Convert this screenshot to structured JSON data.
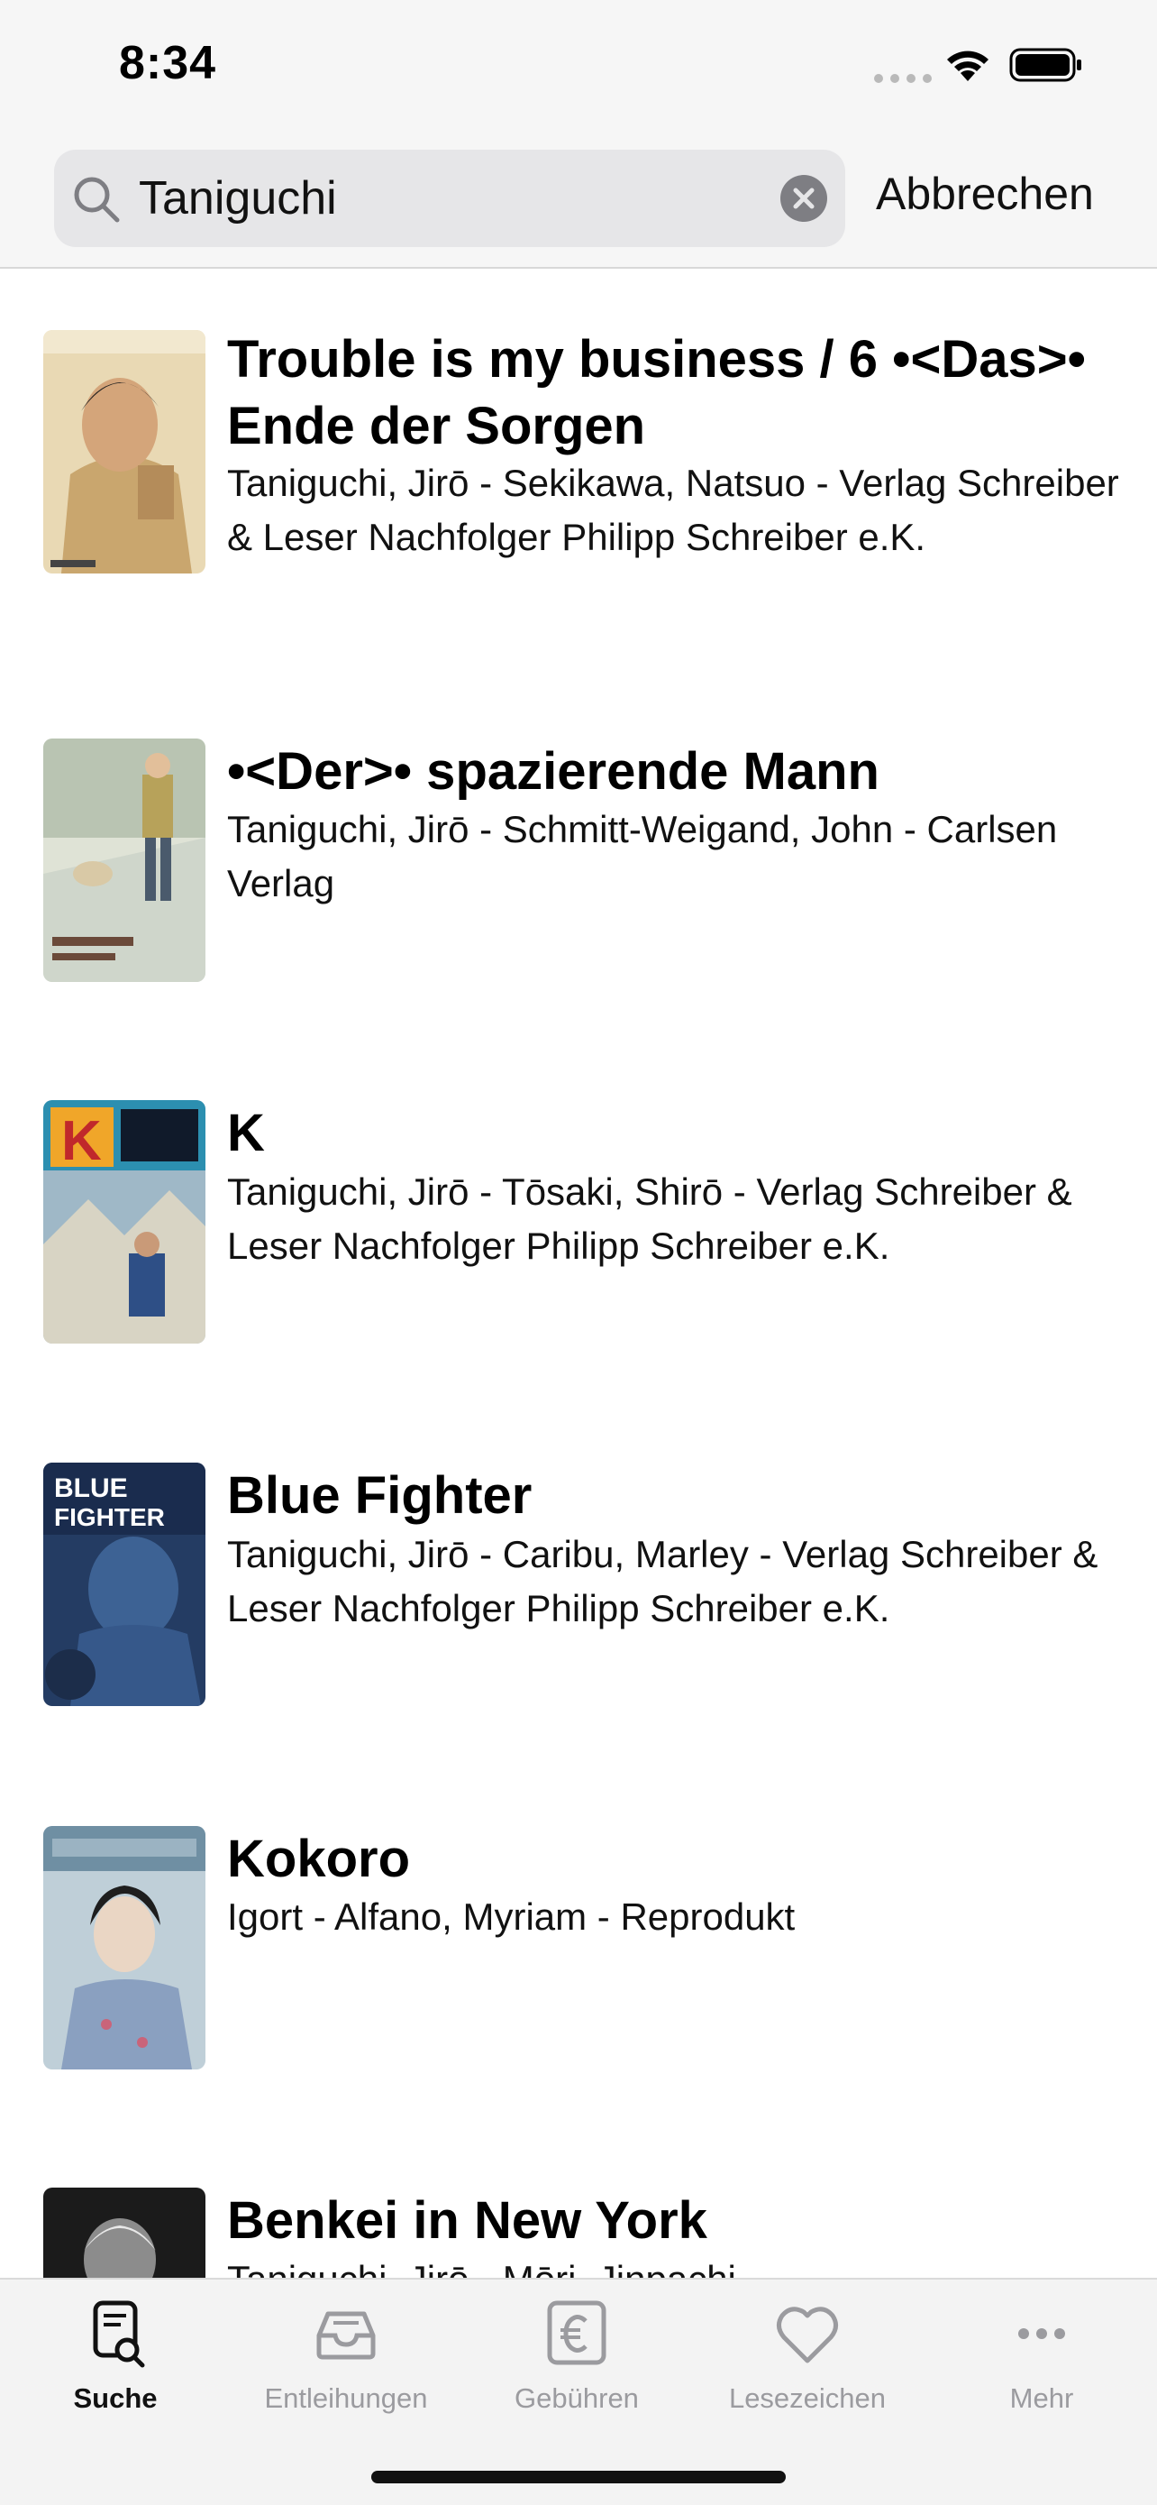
{
  "status_bar": {
    "time": "8:34"
  },
  "search": {
    "query": "Taniguchi",
    "cancel_label": "Abbrechen"
  },
  "results": [
    {
      "title": "Trouble is my business / 6 •<Das>• Ende der Sorgen",
      "meta": "Taniguchi, Jirō - Sekikawa, Natsuo - Verlag Schreiber & Leser Nachfolger Philipp Schreiber e.K."
    },
    {
      "title": "•<Der>• spazierende Mann",
      "meta": "Taniguchi, Jirō - Schmitt-Weigand, John - Carlsen Verlag"
    },
    {
      "title": "K",
      "meta": "Taniguchi, Jirō - Tōsaki, Shirō - Verlag Schreiber & Leser Nachfolger Philipp Schreiber e.K."
    },
    {
      "title": "Blue Fighter",
      "meta": "Taniguchi, Jirō - Caribu, Marley - Verlag Schreiber & Leser Nachfolger Philipp Schreiber e.K."
    },
    {
      "title": "Kokoro",
      "meta": "Igort - Alfano, Myriam - Reprodukt"
    },
    {
      "title": "Benkei in New York",
      "meta": "Taniguchi, Jirō - Mōri, Jinpachi"
    }
  ],
  "tabs": [
    {
      "label": "Suche",
      "icon": "search-document-icon",
      "active": true
    },
    {
      "label": "Entleihungen",
      "icon": "tray-icon",
      "active": false
    },
    {
      "label": "Gebühren",
      "icon": "euro-icon",
      "active": false
    },
    {
      "label": "Lesezeichen",
      "icon": "heart-icon",
      "active": false
    },
    {
      "label": "Mehr",
      "icon": "more-icon",
      "active": false
    }
  ],
  "colors": {
    "accent": "#111111",
    "tab_inactive": "#9b9b9f",
    "search_field": "#e6e6e8"
  }
}
